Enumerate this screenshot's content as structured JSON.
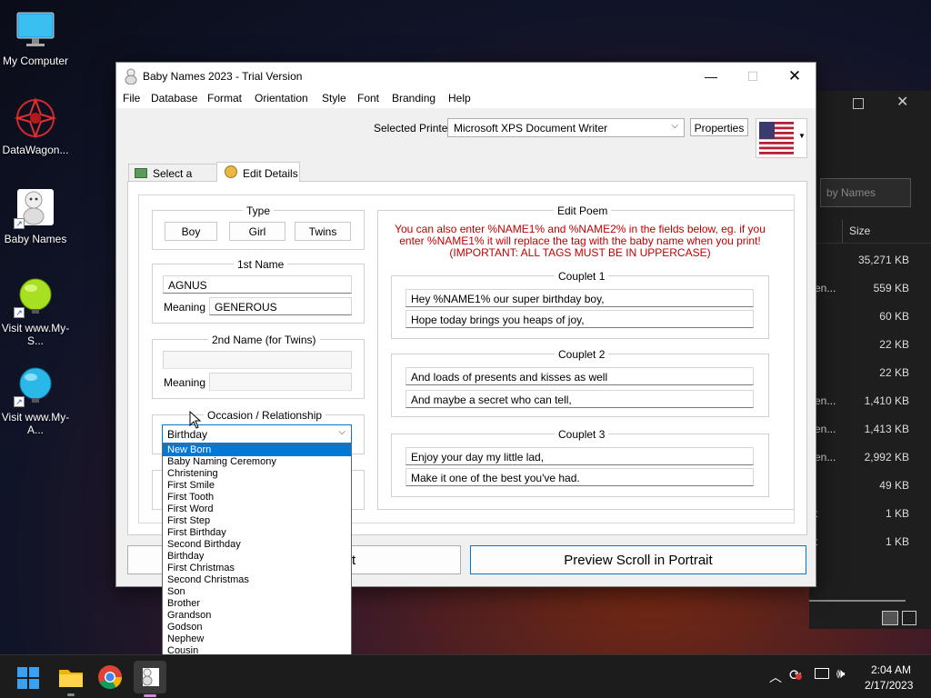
{
  "desktop": {
    "icons": [
      {
        "label": "My Computer"
      },
      {
        "label": "DataWagon..."
      },
      {
        "label": "Baby Names"
      },
      {
        "label": "Visit www.My-S..."
      },
      {
        "label": "Visit www.My-A..."
      }
    ]
  },
  "background_window": {
    "search_placeholder": "by Names",
    "size_header": "Size",
    "rows": [
      {
        "left": "",
        "size": "35,271 KB"
      },
      {
        "left": "en...",
        "size": "559 KB"
      },
      {
        "left": "",
        "size": "60 KB"
      },
      {
        "left": "",
        "size": "22 KB"
      },
      {
        "left": "",
        "size": "22 KB"
      },
      {
        "left": "en...",
        "size": "1,410 KB"
      },
      {
        "left": "en...",
        "size": "1,413 KB"
      },
      {
        "left": "en...",
        "size": "2,992 KB"
      },
      {
        "left": "",
        "size": "49 KB"
      },
      {
        "left": "t",
        "size": "1 KB"
      },
      {
        "left": "t",
        "size": "1 KB"
      }
    ]
  },
  "window": {
    "title": "Baby Names 2023 - Trial Version",
    "menu": [
      "File",
      "Database",
      "Format",
      "Orientation",
      "Style",
      "Font",
      "Branding",
      "Help"
    ],
    "printer_label": "Selected Printer",
    "printer_value": "Microsoft XPS Document Writer",
    "properties_label": "Properties",
    "tabs": [
      "Select a Style",
      "Edit Details"
    ],
    "type": {
      "title": "Type",
      "buttons": [
        "Boy",
        "Girl",
        "Twins"
      ]
    },
    "first_name": {
      "title": "1st Name",
      "value": "AGNUS",
      "meaning_label": "Meaning",
      "meaning_value": "GENEROUS"
    },
    "second_name": {
      "title": "2nd Name (for Twins)",
      "value": "",
      "meaning_label": "Meaning",
      "meaning_value": ""
    },
    "occasion": {
      "title": "Occasion / Relationship",
      "selected": "Birthday",
      "options": [
        "New Born",
        "Baby Naming Ceremony",
        "Christening",
        "First Smile",
        "First Tooth",
        "First Word",
        "First Step",
        "First Birthday",
        "Second Birthday",
        "Birthday",
        "First Christmas",
        "Second Christmas",
        "Son",
        "Brother",
        "Grandson",
        "Godson",
        "Nephew",
        "Cousin"
      ],
      "highlighted": "New Born"
    },
    "poem": {
      "title": "Edit Poem",
      "note_line1": "You can also enter %NAME1% and %NAME2% in the fields below, eg. if you",
      "note_line2": "enter %NAME1% it will replace the tag with the baby name when you print!",
      "note_line3": "(IMPORTANT: ALL TAGS MUST BE IN UPPERCASE)",
      "couplets": [
        {
          "title": "Couplet 1",
          "line1": "Hey %NAME1% our super birthday boy,",
          "line2": "Hope today brings you heaps of joy,"
        },
        {
          "title": "Couplet 2",
          "line1": "And loads of presents and kisses as well",
          "line2": "And maybe a secret who can tell,"
        },
        {
          "title": "Couplet 3",
          "line1": "Enjoy your day my little lad,",
          "line2": "Make it one of the best you've had."
        }
      ]
    },
    "left_button_visible_text": "t",
    "preview_button": "Preview Scroll in Portrait"
  },
  "taskbar": {
    "time": "2:04 AM",
    "date": "2/17/2023"
  },
  "colors": {
    "accent": "#0078d4",
    "note_red": "#c00000",
    "selection": "#0078d7"
  }
}
